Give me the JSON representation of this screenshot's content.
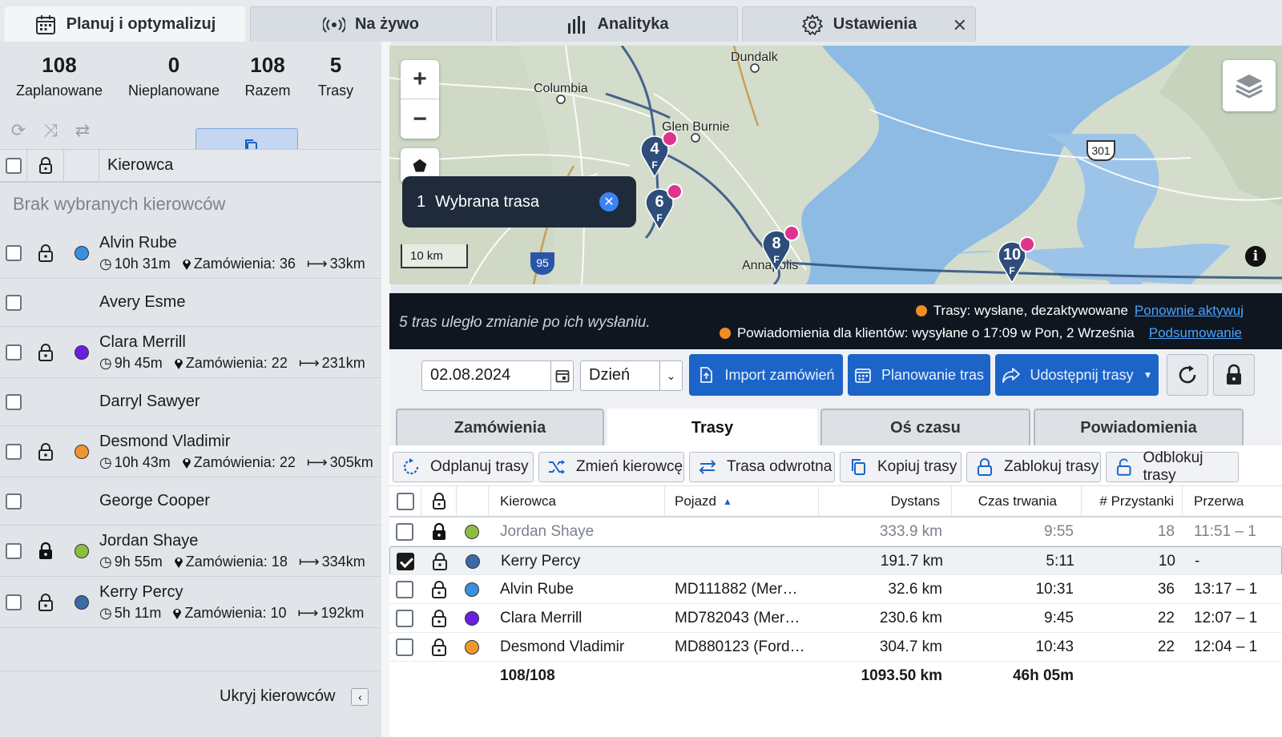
{
  "tabs": [
    {
      "label": "Planuj i optymalizuj",
      "icon": "calendar-icon",
      "active": true
    },
    {
      "label": "Na żywo",
      "icon": "broadcast-icon"
    },
    {
      "label": "Analityka",
      "icon": "bar-chart-icon"
    },
    {
      "label": "Ustawienia",
      "icon": "gear-icon",
      "closable": true
    }
  ],
  "stats": [
    {
      "value": "108",
      "label": "Zaplanowane"
    },
    {
      "value": "0",
      "label": "Nieplanowane"
    },
    {
      "value": "108",
      "label": "Razem"
    },
    {
      "value": "5",
      "label": "Trasy"
    }
  ],
  "driver_header": "Kierowca",
  "no_selected": "Brak wybranych kierowców",
  "drivers": [
    {
      "name": "Alvin Rube",
      "color": "#3b8fe0",
      "time": "10h 31m",
      "orders": "Zamówienia: 36",
      "distance": "33km",
      "locked": false
    },
    {
      "name": "Avery Esme"
    },
    {
      "name": "Clara Merrill",
      "color": "#6a1ee0",
      "time": "9h 45m",
      "orders": "Zamówienia: 22",
      "distance": "231km",
      "locked": false
    },
    {
      "name": "Darryl Sawyer"
    },
    {
      "name": "Desmond Vladimir",
      "color": "#f0962e",
      "time": "10h 43m",
      "orders": "Zamówienia: 22",
      "distance": "305km",
      "locked": false
    },
    {
      "name": "George Cooper"
    },
    {
      "name": "Jordan Shaye",
      "color": "#8cbf3f",
      "time": "9h 55m",
      "orders": "Zamówienia: 18",
      "distance": "334km",
      "locked": true
    },
    {
      "name": "Kerry Percy",
      "color": "#3a6aa8",
      "time": "5h 11m",
      "orders": "Zamówienia: 10",
      "distance": "192km",
      "locked": false
    }
  ],
  "hide_drivers": "Ukryj kierowców",
  "map": {
    "labels": {
      "dundalk": "Dundalk",
      "columbia": "Columbia",
      "glen_burnie": "Glen Burnie",
      "annapolis": "Annapolis",
      "shield_301": "301",
      "shield_95": "95"
    },
    "scale": "10 km",
    "selected_route_count": "1",
    "selected_route_label": "Wybrana trasa",
    "pins": [
      {
        "num": "4",
        "sub": "F",
        "color": "#2e4d7a"
      },
      {
        "num": "6",
        "sub": "F",
        "color": "#2e4d7a"
      },
      {
        "num": "8",
        "sub": "F",
        "color": "#2e4d7a"
      },
      {
        "num": "10",
        "sub": "F",
        "color": "#2e4d7a"
      }
    ]
  },
  "notice": {
    "message": "5 tras uległo zmianie po ich wysłaniu.",
    "line1": "Trasy: wysłane, dezaktywowane",
    "line1_link": "Ponownie aktywuj",
    "line2": "Powiadomienia dla klientów: wysyłane o 17:09 w Pon, 2 Września",
    "line2_link": "Podsumowanie"
  },
  "toolbar": {
    "date": "02.08.2024",
    "period": "Dzień",
    "import": "Import zamówień",
    "planning": "Planowanie tras",
    "share": "Udostępnij trasy"
  },
  "subtabs": [
    "Zamówienia",
    "Trasy",
    "Oś czasu",
    "Powiadomienia"
  ],
  "actions": [
    "Odplanuj trasy",
    "Zmień kierowcę",
    "Trasa odwrotna",
    "Kopiuj trasy",
    "Zablokuj trasy",
    "Odblokuj trasy"
  ],
  "table": {
    "headers": {
      "driver": "Kierowca",
      "vehicle": "Pojazd",
      "distance": "Dystans",
      "duration": "Czas trwania",
      "stops": "# Przystanki",
      "break": "Przerwa"
    },
    "rows": [
      {
        "driver": "Jordan Shaye",
        "color": "#8cbf3f",
        "vehicle": "",
        "distance": "333.9 km",
        "duration": "9:55",
        "stops": "18",
        "break": "11:51 – 1",
        "locked": true,
        "checked": false,
        "grey": true
      },
      {
        "driver": "Kerry Percy",
        "color": "#3a6aa8",
        "vehicle": "",
        "distance": "191.7 km",
        "duration": "5:11",
        "stops": "10",
        "break": "-",
        "locked": false,
        "checked": true
      },
      {
        "driver": "Alvin Rube",
        "color": "#3b8fe0",
        "vehicle": "MD111882 (Mer…",
        "distance": "32.6 km",
        "duration": "10:31",
        "stops": "36",
        "break": "13:17 – 1",
        "locked": false,
        "checked": false
      },
      {
        "driver": "Clara Merrill",
        "color": "#6a1ee0",
        "vehicle": "MD782043 (Mer…",
        "distance": "230.6 km",
        "duration": "9:45",
        "stops": "22",
        "break": "12:07 – 1",
        "locked": false,
        "checked": false
      },
      {
        "driver": "Desmond Vladimir",
        "color": "#f0962e",
        "vehicle": "MD880123 (Ford…",
        "distance": "304.7 km",
        "duration": "10:43",
        "stops": "22",
        "break": "12:04 – 1",
        "locked": false,
        "checked": false
      }
    ],
    "totals": {
      "orders": "108/108",
      "distance": "1093.50 km",
      "duration": "46h 05m"
    }
  }
}
